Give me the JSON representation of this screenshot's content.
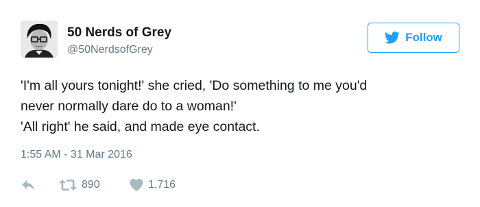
{
  "author": {
    "display_name": "50 Nerds of Grey",
    "handle": "@50NerdsofGrey",
    "avatar_icon": "profile-photo"
  },
  "follow_button": {
    "label": "Follow",
    "icon": "twitter-bird-icon",
    "color": "#1da1f2"
  },
  "tweet": {
    "lines": [
      "'I'm all yours tonight!' she cried, 'Do something to me you'd",
      "never normally dare do to a woman!'",
      "'All right' he said, and made eye contact."
    ],
    "timestamp": "1:55 AM - 31 Mar 2016"
  },
  "actions": {
    "reply_icon": "reply-icon",
    "retweet_icon": "retweet-icon",
    "retweet_count": "890",
    "like_icon": "heart-icon",
    "like_count": "1,716",
    "icon_color": "#aab8c2"
  }
}
